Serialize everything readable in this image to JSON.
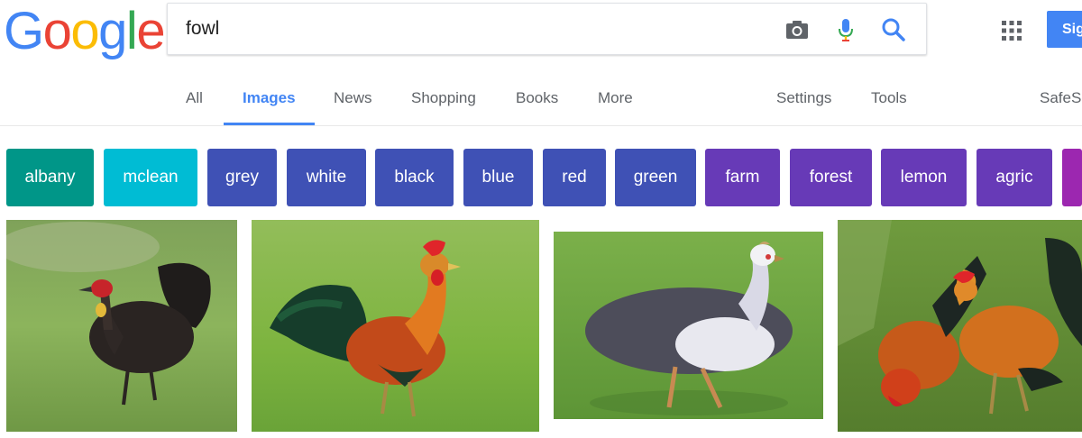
{
  "logo": {
    "letters": [
      "G",
      "o",
      "o",
      "g",
      "l",
      "e"
    ]
  },
  "search": {
    "query": "fowl"
  },
  "header": {
    "signin_label": "Sign in"
  },
  "tabs": [
    {
      "label": "All",
      "active": false
    },
    {
      "label": "Images",
      "active": true
    },
    {
      "label": "News",
      "active": false
    },
    {
      "label": "Shopping",
      "active": false
    },
    {
      "label": "Books",
      "active": false
    },
    {
      "label": "More",
      "active": false
    },
    {
      "label": "Settings",
      "active": false
    },
    {
      "label": "Tools",
      "active": false
    },
    {
      "label": "SafeSearch",
      "active": false
    }
  ],
  "chips": [
    {
      "label": "albany",
      "color": "#009688"
    },
    {
      "label": "mclean",
      "color": "#00bcd4"
    },
    {
      "label": "grey",
      "color": "#3f51b5"
    },
    {
      "label": "white",
      "color": "#3f51b5"
    },
    {
      "label": "black",
      "color": "#3f51b5"
    },
    {
      "label": "blue",
      "color": "#3f51b5"
    },
    {
      "label": "red",
      "color": "#3f51b5"
    },
    {
      "label": "green",
      "color": "#3f51b5"
    },
    {
      "label": "farm",
      "color": "#673ab7"
    },
    {
      "label": "forest",
      "color": "#673ab7"
    },
    {
      "label": "lemon",
      "color": "#673ab7"
    },
    {
      "label": "agric",
      "color": "#673ab7"
    },
    {
      "label": "",
      "color": "#9c27b0"
    }
  ],
  "results": [
    {
      "subject": "brush turkey on grass"
    },
    {
      "subject": "red junglefowl rooster on grass"
    },
    {
      "subject": "helmeted guineafowl on grass"
    },
    {
      "subject": "two roosters pecking grass"
    }
  ],
  "colors": {
    "accent": "#4285f4",
    "text_muted": "#5f6368"
  }
}
